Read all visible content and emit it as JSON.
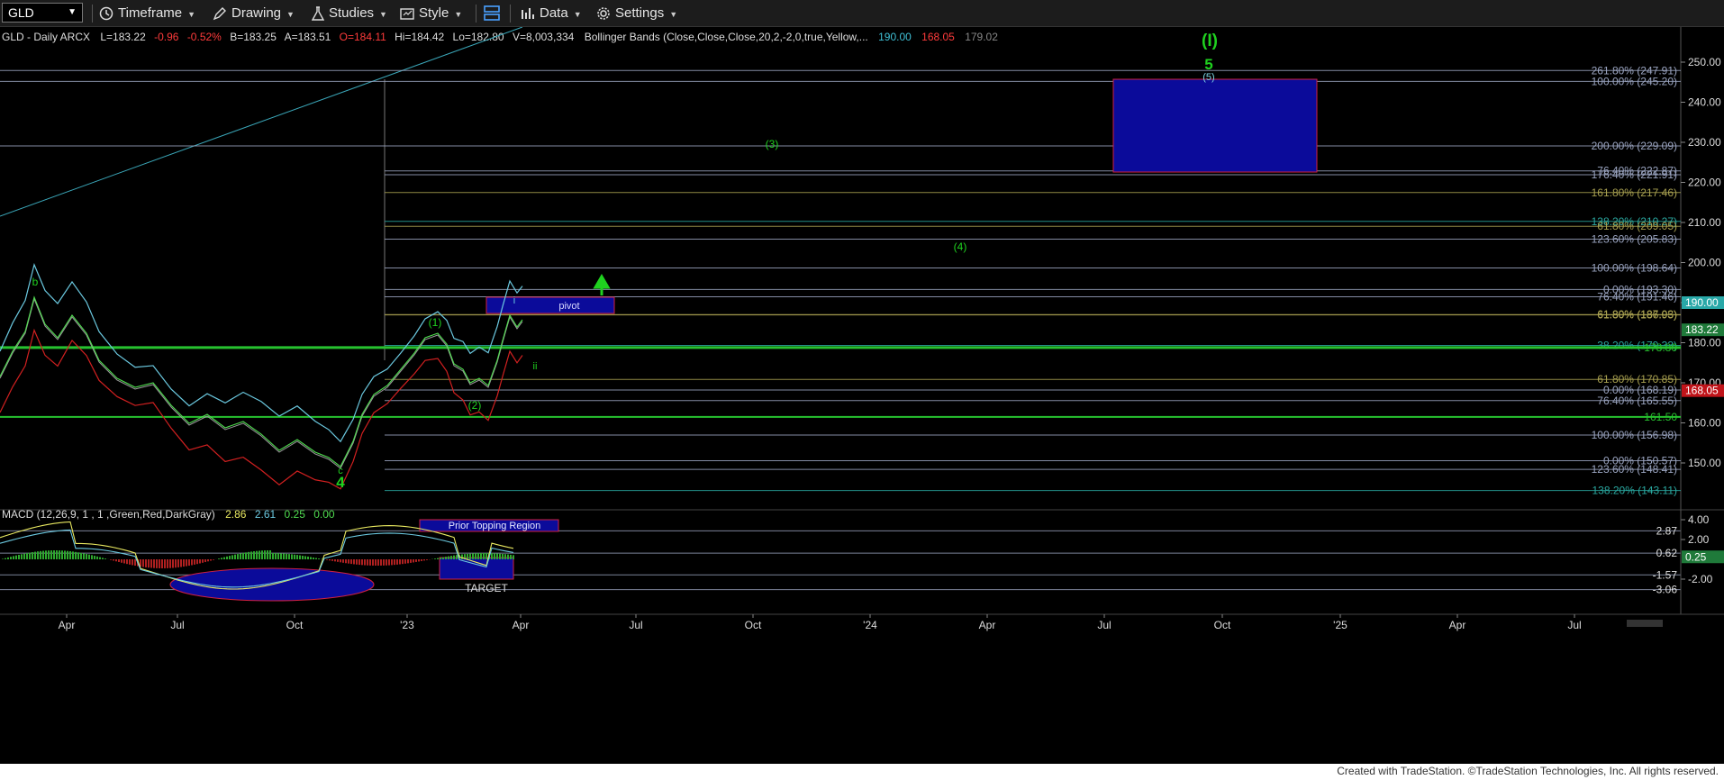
{
  "toolbar": {
    "symbol": "GLD",
    "timeframe_label": "Timeframe",
    "drawing_label": "Drawing",
    "studies_label": "Studies",
    "style_label": "Style",
    "data_label": "Data",
    "settings_label": "Settings"
  },
  "chart_data": [
    {
      "type": "line",
      "panel": "price",
      "header": {
        "symbol_info": "GLD - Daily  ARCX",
        "last": "L=183.22",
        "change": "-0.96",
        "pct": "-0.52%",
        "bid": "B=183.25",
        "ask": "A=183.51",
        "open": "O=184.11",
        "high": "Hi=184.42",
        "low": "Lo=182.80",
        "volume": "V=8,003,334",
        "study": "Bollinger Bands (Close,Close,Close,20,2,-2,0,true,Yellow,...",
        "bb_upper": "190.00",
        "bb_lower": "168.05",
        "bb_mid": "179.02"
      },
      "x_ticks": [
        "Apr",
        "Jul",
        "Oct",
        "'23",
        "Apr",
        "Jul",
        "Oct",
        "'24",
        "Apr",
        "Jul",
        "Oct",
        "'25",
        "Apr",
        "Jul"
      ],
      "y_ticks": [
        "250.00",
        "240.00",
        "230.00",
        "220.00",
        "210.00",
        "200.00",
        "190.00",
        "180.00",
        "170.00",
        "160.00",
        "150.00"
      ],
      "ylim": [
        141,
        256
      ],
      "price_badges": [
        {
          "value": 190.0,
          "label": "190.00",
          "color": "#29a8a8"
        },
        {
          "value": 183.22,
          "label": "183.22",
          "color": "#1f7a3a"
        },
        {
          "value": 168.05,
          "label": "168.05",
          "color": "#c0141a"
        }
      ],
      "fib_levels": [
        {
          "value": 247.91,
          "label": "261.80% (247.91)",
          "color": "#9aa4c0"
        },
        {
          "value": 245.2,
          "label": "100.00% (245.20)",
          "color": "#9aa4c0"
        },
        {
          "value": 229.09,
          "label": "200.00% (229.09)",
          "color": "#9aa4c0"
        },
        {
          "value": 222.87,
          "label": "76.40% (222.87)",
          "color": "#9aa4c0"
        },
        {
          "value": 221.91,
          "label": "176.40% (221.91)",
          "color": "#9aa4c0"
        },
        {
          "value": 217.46,
          "label": "161.80% (217.46)",
          "color": "#a8a050"
        },
        {
          "value": 210.27,
          "label": "138.20% (210.27)",
          "color": "#2aa8a0"
        },
        {
          "value": 209.05,
          "label": "61.80% (209.05)",
          "color": "#a8a050"
        },
        {
          "value": 205.83,
          "label": "123.60% (205.83)",
          "color": "#9aa4c0"
        },
        {
          "value": 198.64,
          "label": "100.00% (198.64)",
          "color": "#9aa4c0"
        },
        {
          "value": 193.3,
          "label": "0.00% (193.30)",
          "color": "#9aa4c0"
        },
        {
          "value": 191.46,
          "label": "76.40% (191.46)",
          "color": "#9aa4c0"
        },
        {
          "value": 187.03,
          "label": "61.80% (187.03)",
          "color": "#a8a050"
        },
        {
          "value": 186.95,
          "label": "61.80% (186.95)",
          "color": "#a8a050"
        },
        {
          "value": 179.33,
          "label": "38.20% (179.33)",
          "color": "#2aa8a0"
        },
        {
          "value": 178.8,
          "label": "178.80",
          "color": "#27c22f"
        },
        {
          "value": 170.85,
          "label": "61.80% (170.85)",
          "color": "#a8a050"
        },
        {
          "value": 168.19,
          "label": "0.00% (168.19)",
          "color": "#9aa4c0"
        },
        {
          "value": 165.55,
          "label": "76.40% (165.55)",
          "color": "#9aa4c0"
        },
        {
          "value": 161.5,
          "label": "161.50",
          "color": "#27c22f"
        },
        {
          "value": 156.98,
          "label": "100.00% (156.98)",
          "color": "#9aa4c0"
        },
        {
          "value": 150.57,
          "label": "0.00% (150.57)",
          "color": "#9aa4c0"
        },
        {
          "value": 148.41,
          "label": "123.60% (148.41)",
          "color": "#9aa4c0"
        },
        {
          "value": 143.11,
          "label": "138.20% (143.11)",
          "color": "#2aa8a0"
        }
      ],
      "wave_labels": [
        "(I)",
        "5",
        "(5)",
        "(3)",
        "(4)",
        "b",
        "(1)",
        "(2)",
        "i",
        "ii",
        "c",
        "4"
      ],
      "annotations": {
        "pivot": "pivot"
      }
    },
    {
      "type": "line",
      "panel": "macd",
      "header": {
        "study": "MACD (12,26,9, 1 , 1 ,Green,Red,DarkGray)",
        "macd": "2.86",
        "signal": "2.61",
        "diff": "0.25",
        "zero": "0.00"
      },
      "y_ticks": [
        "4.00",
        "2.00",
        "-2.00"
      ],
      "ylim": [
        -4.2,
        4.6
      ],
      "level_labels": [
        {
          "value": 2.87,
          "label": "2.87"
        },
        {
          "value": 0.62,
          "label": "0.62"
        },
        {
          "value": -1.57,
          "label": "-1.57"
        },
        {
          "value": -3.06,
          "label": "-3.06"
        }
      ],
      "badge": {
        "value": 0.25,
        "label": "0.25"
      },
      "annotations": {
        "prior_top": "Prior Topping Region",
        "target": "TARGET"
      }
    }
  ],
  "footer": {
    "copyright": "Created with TradeStation. ©TradeStation Technologies, Inc. All rights reserved."
  }
}
